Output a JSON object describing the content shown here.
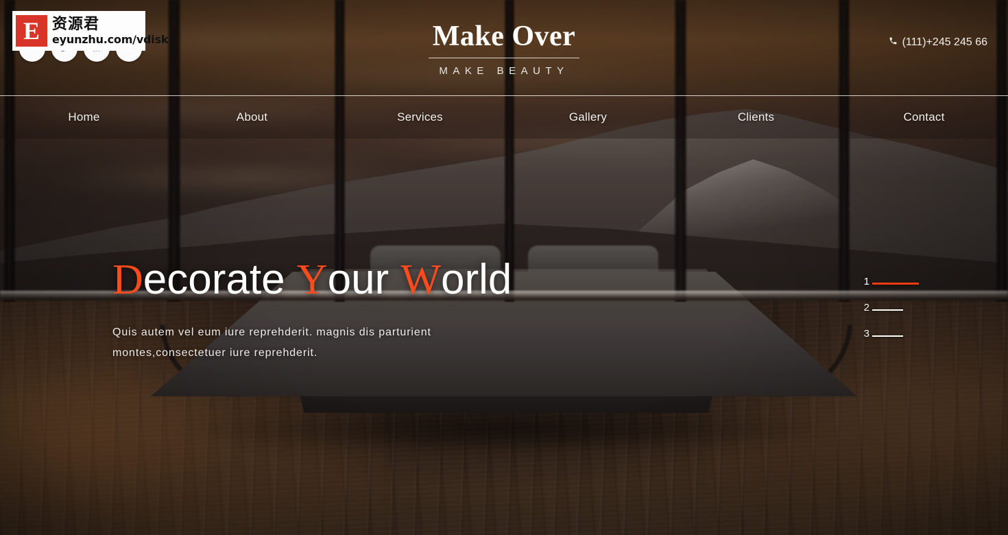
{
  "site": {
    "brand_title": "Make Over",
    "brand_subtitle": "MAKE BEAUTY",
    "phone": "(111)+245 245 66",
    "phone_icon": "phone-icon"
  },
  "socials": [
    {
      "name": "facebook",
      "icon": "facebook-icon",
      "glyph": "f"
    },
    {
      "name": "twitter",
      "icon": "twitter-icon",
      "glyph": "t"
    },
    {
      "name": "rss",
      "icon": "rss-icon",
      "glyph": "r"
    },
    {
      "name": "vk",
      "icon": "vk-icon",
      "glyph": "vk"
    }
  ],
  "nav": {
    "items": [
      {
        "label": "Home"
      },
      {
        "label": "About"
      },
      {
        "label": "Services"
      },
      {
        "label": "Gallery"
      },
      {
        "label": "Clients"
      },
      {
        "label": "Contact"
      }
    ]
  },
  "hero": {
    "title_parts": [
      {
        "text": "D",
        "accent": true
      },
      {
        "text": "ecorate ",
        "accent": false
      },
      {
        "text": "Y",
        "accent": true
      },
      {
        "text": "our ",
        "accent": false
      },
      {
        "text": "W",
        "accent": true
      },
      {
        "text": "orld",
        "accent": false
      }
    ],
    "title_plain": "Decorate Your World",
    "subtitle": "Quis autem vel eum iure reprehderit. magnis dis parturient montes,consectetuer iure reprehderit."
  },
  "pager": {
    "items": [
      {
        "number": "1",
        "active": true
      },
      {
        "number": "2",
        "active": false
      },
      {
        "number": "3",
        "active": false
      }
    ]
  },
  "watermark": {
    "badge_letter": "E",
    "cn_text": "资源君",
    "url_text": "eyunzhu.com/vdisk"
  },
  "colors": {
    "accent": "#ff4a1e",
    "pager_active": "#ff3b12",
    "text": "#ffffff",
    "watermark_badge": "#d8342a",
    "header_overlay": "rgba(22,16,13,.42)"
  }
}
